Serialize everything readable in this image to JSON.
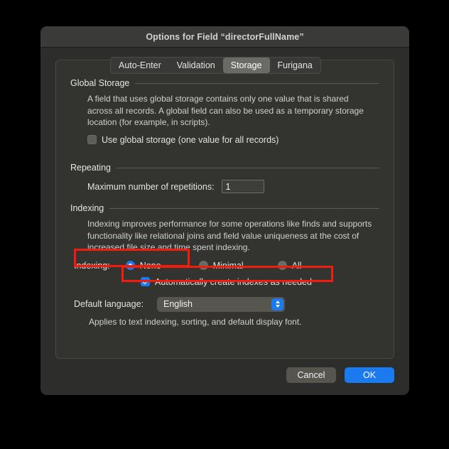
{
  "window": {
    "title": "Options for Field “directorFullName”"
  },
  "tabs": [
    {
      "label": "Auto-Enter",
      "selected": false
    },
    {
      "label": "Validation",
      "selected": false
    },
    {
      "label": "Storage",
      "selected": true
    },
    {
      "label": "Furigana",
      "selected": false
    }
  ],
  "global_storage": {
    "section_title": "Global Storage",
    "description": "A field that uses global storage contains only one value that is shared across all records.  A global field can also be used as a temporary storage location (for example, in scripts).",
    "use_global_label": "Use global storage (one value for all records)",
    "use_global_checked": false
  },
  "repeating": {
    "section_title": "Repeating",
    "max_repetitions_label": "Maximum number of repetitions:",
    "max_repetitions_value": "1"
  },
  "indexing": {
    "section_title": "Indexing",
    "description": "Indexing improves performance for some operations like finds and supports functionality like relational joins and field value uniqueness at the cost of increased file size and time spent indexing.",
    "indexing_label": "Indexing:",
    "options": [
      {
        "label": "None",
        "selected": true
      },
      {
        "label": "Minimal",
        "selected": false
      },
      {
        "label": "All",
        "selected": false
      }
    ],
    "auto_index_label": "Automatically create indexes as needed",
    "auto_index_checked": true,
    "default_language_label": "Default language:",
    "default_language_value": "English",
    "default_language_note": "Applies to text indexing, sorting, and default display font."
  },
  "footer": {
    "cancel_label": "Cancel",
    "ok_label": "OK"
  },
  "annotations": {
    "color": "#f21b0c",
    "boxes": [
      {
        "name": "indexing-none-highlight"
      },
      {
        "name": "auto-index-highlight"
      }
    ]
  }
}
